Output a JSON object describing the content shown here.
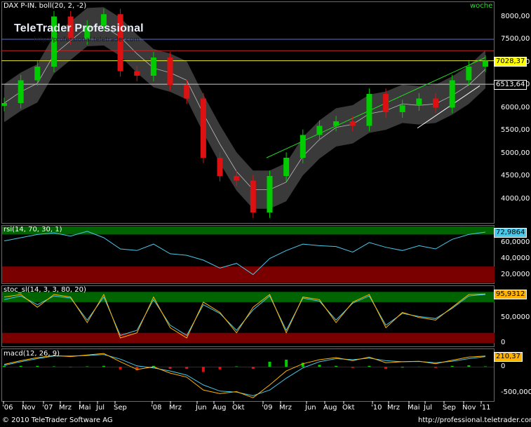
{
  "chart_title": "DAX P-IN. boll(20, 2, -2)",
  "period_label": "woche",
  "watermark": {
    "title": "TeleTrader Professional",
    "url": "http://professional.teletrader.com"
  },
  "footer": {
    "copyright": "© 2010 TeleTrader Software AG",
    "url": "http://professional.teletrader.com"
  },
  "colors": {
    "up": "#00cc00",
    "down": "#dd1111",
    "rsi": "#49c8e8",
    "stoch_k": "#ffb300",
    "stoch_d": "#49c8e8",
    "overbought_zone": "#006400",
    "oversold_zone": "#7a0000",
    "band_fill": "#3a3a3a"
  },
  "chart_data": [
    {
      "type": "line",
      "name": "price",
      "title": "DAX P-IN. boll(20, 2, -2)",
      "ylim": [
        3500,
        8300
      ],
      "yticks": [
        "8000,00",
        "7500,00",
        "7000,00",
        "6500,00",
        "6000,00",
        "5500,00",
        "5000,00",
        "4500,00",
        "4000,00"
      ],
      "last_value": "7028,37",
      "marker_value": "6513,64",
      "horizontal_lines": [
        7500,
        7250,
        7028.37,
        6513.64
      ],
      "x": [
        "2006-10",
        "2006-12",
        "2007-03",
        "2007-06",
        "2007-07",
        "2007-09",
        "2007-12",
        "2008-01",
        "2008-03",
        "2008-05",
        "2008-06",
        "2008-09",
        "2008-10",
        "2008-11",
        "2009-01",
        "2009-03",
        "2009-04",
        "2009-06",
        "2009-08",
        "2009-10",
        "2010-01",
        "2010-02",
        "2010-04",
        "2010-05",
        "2010-06",
        "2010-07",
        "2010-08",
        "2010-10",
        "2010-11",
        "2010-12"
      ],
      "close": [
        6100,
        6600,
        6900,
        8000,
        7500,
        7800,
        8050,
        6800,
        6700,
        7100,
        6500,
        6200,
        4900,
        4500,
        4400,
        3700,
        4500,
        4900,
        5400,
        5600,
        5700,
        5600,
        6300,
        5900,
        6050,
        6200,
        6000,
        6600,
        6900,
        7028
      ]
    },
    {
      "type": "line",
      "name": "rsi",
      "title": "rsi(14, 70, 30, 1)",
      "ylim": [
        10,
        80
      ],
      "zones": {
        "upper": 70,
        "lower": 30
      },
      "yticks": [
        "60,0000",
        "40,0000",
        "20,0000"
      ],
      "last_value": "72,9864",
      "values": [
        62,
        66,
        70,
        72,
        68,
        74,
        66,
        52,
        50,
        58,
        46,
        44,
        38,
        28,
        34,
        20,
        40,
        50,
        58,
        56,
        55,
        48,
        60,
        54,
        50,
        56,
        52,
        64,
        70,
        73
      ]
    },
    {
      "type": "line",
      "name": "stoch_sl",
      "title": "stoc_sl(14, 3, 3, 80, 20)",
      "ylim": [
        -5,
        110
      ],
      "zones": {
        "upper": 80,
        "lower": 20
      },
      "yticks": [
        "50,0000",
        "0"
      ],
      "last_value": "95,9312",
      "k": [
        90,
        95,
        70,
        95,
        90,
        40,
        95,
        10,
        20,
        90,
        30,
        10,
        80,
        60,
        20,
        70,
        95,
        20,
        90,
        85,
        40,
        80,
        95,
        30,
        60,
        50,
        45,
        70,
        95,
        96
      ],
      "d": [
        85,
        92,
        75,
        92,
        88,
        45,
        90,
        15,
        25,
        85,
        35,
        15,
        75,
        58,
        25,
        65,
        92,
        25,
        88,
        82,
        45,
        78,
        92,
        35,
        58,
        52,
        48,
        68,
        92,
        95
      ]
    },
    {
      "type": "line",
      "name": "macd",
      "title": "macd(12, 26, 9)",
      "ylim": [
        -650,
        330
      ],
      "yticks": [
        "0",
        "-500,000"
      ],
      "last_value": "210,37",
      "macd": [
        50,
        120,
        180,
        220,
        200,
        230,
        260,
        100,
        -50,
        0,
        -120,
        -200,
        -450,
        -520,
        -480,
        -600,
        -350,
        -80,
        60,
        140,
        180,
        120,
        190,
        80,
        100,
        110,
        60,
        130,
        190,
        210
      ],
      "signal": [
        30,
        100,
        160,
        210,
        210,
        220,
        240,
        150,
        20,
        -20,
        -80,
        -160,
        -350,
        -470,
        -490,
        -560,
        -450,
        -220,
        -20,
        100,
        160,
        140,
        170,
        120,
        100,
        105,
        80,
        110,
        160,
        200
      ]
    }
  ],
  "x_ticks": [
    "'06",
    "Nov",
    "'07",
    "Mrz",
    "Mai",
    "Jul",
    "Sep",
    "'08",
    "Mrz",
    "Jun",
    "Aug",
    "Okt",
    "'09",
    "Mrz",
    "Jun",
    "Aug",
    "Okt",
    "'10",
    "Mrz",
    "Mai",
    "Jul",
    "Sep",
    "Nov",
    "'11"
  ]
}
